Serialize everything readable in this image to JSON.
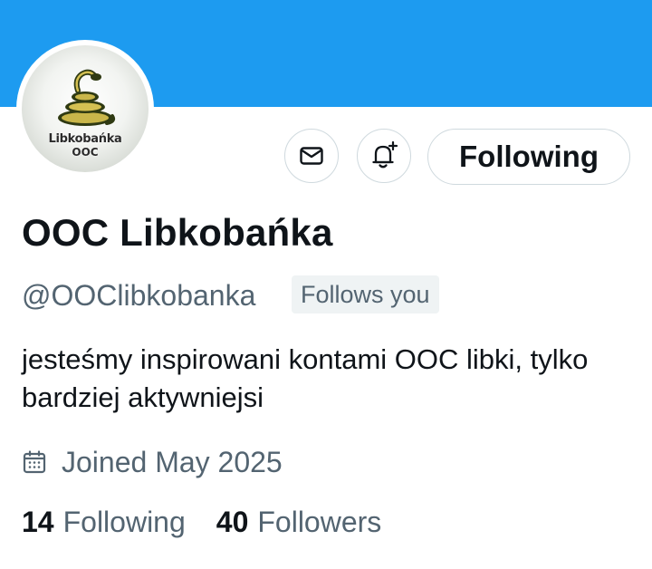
{
  "profile": {
    "avatar_text_line1": "Libkobańka",
    "avatar_text_line2": "OOC",
    "display_name": "OOC Libkobańka",
    "handle": "@OOClibkobanka",
    "follows_you": "Follows you",
    "bio": "jesteśmy inspirowani kontami OOC libki, tylko bardziej aktywniejsi",
    "joined": "Joined May 2025"
  },
  "actions": {
    "message_icon": "mail-icon",
    "notify_icon": "bell-plus-icon",
    "follow_label": "Following"
  },
  "stats": {
    "following_count": "14",
    "following_label": "Following",
    "followers_count": "40",
    "followers_label": "Followers"
  },
  "colors": {
    "banner": "#1d9bf0",
    "text_primary": "#0f1419",
    "text_secondary": "#536471",
    "border": "#cfd9de"
  }
}
